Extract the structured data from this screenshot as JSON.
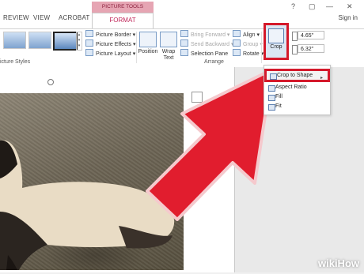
{
  "ribbon": {
    "tabs": [
      "REVIEW",
      "VIEW",
      "ACROBAT"
    ],
    "context_header": "PICTURE TOOLS",
    "active_tab": "FORMAT",
    "sign_in": "Sign in",
    "window_buttons": [
      "?",
      "▢",
      "—",
      "✕"
    ]
  },
  "picture_styles": {
    "group_label": "icture Styles",
    "picture_border": "Picture Border ▾",
    "picture_effects": "Picture Effects ▾",
    "picture_layout": "Picture Layout ▾"
  },
  "arrange": {
    "position": "Position",
    "wrap_text": "Wrap Text",
    "bring_forward": "Bring Forward ▾",
    "send_backward": "Send Backward ▾",
    "selection_pane": "Selection Pane",
    "align": "Align ▾",
    "group": "Group ▾",
    "rotate": "Rotate ▾",
    "group_label": "Arrange"
  },
  "size": {
    "crop": "Crop",
    "height": "4.65\"",
    "width": "6.32\""
  },
  "crop_menu": {
    "items": [
      "Crop to Shape",
      "Aspect Ratio",
      "Fill",
      "Fit"
    ]
  },
  "watermark": "wikiHow",
  "colors": {
    "highlight": "#d4192b",
    "context_tab": "#e6a5b3",
    "format_tab_text": "#c0285b",
    "pointer_arrow": "#e11d2e"
  },
  "icons": [
    "picture-border-icon",
    "picture-effects-icon",
    "picture-layout-icon",
    "position-icon",
    "wrap-text-icon",
    "crop-icon",
    "crop-to-shape-icon",
    "pointer-arrow"
  ]
}
